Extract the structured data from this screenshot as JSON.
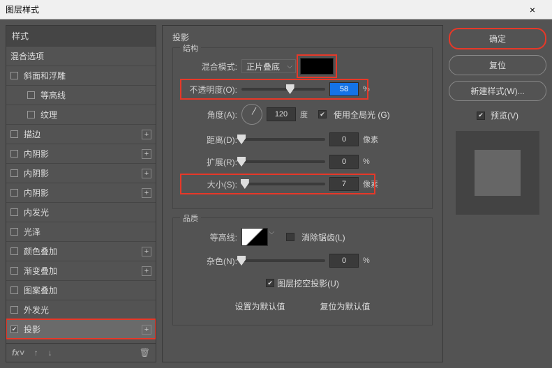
{
  "window": {
    "title": "图层样式",
    "close": "×"
  },
  "left": {
    "header": "样式",
    "blend_opts": "混合选项",
    "items": [
      {
        "label": "斜面和浮雕",
        "chk": false,
        "plus": false,
        "sub": false
      },
      {
        "label": "等高线",
        "chk": false,
        "plus": false,
        "sub": true
      },
      {
        "label": "纹理",
        "chk": false,
        "plus": false,
        "sub": true
      },
      {
        "label": "描边",
        "chk": false,
        "plus": true,
        "sub": false
      },
      {
        "label": "内阴影",
        "chk": false,
        "plus": true,
        "sub": false
      },
      {
        "label": "内阴影",
        "chk": false,
        "plus": true,
        "sub": false
      },
      {
        "label": "内阴影",
        "chk": false,
        "plus": true,
        "sub": false
      },
      {
        "label": "内发光",
        "chk": false,
        "plus": false,
        "sub": false
      },
      {
        "label": "光泽",
        "chk": false,
        "plus": false,
        "sub": false
      },
      {
        "label": "颜色叠加",
        "chk": false,
        "plus": true,
        "sub": false
      },
      {
        "label": "渐变叠加",
        "chk": false,
        "plus": true,
        "sub": false
      },
      {
        "label": "图案叠加",
        "chk": false,
        "plus": false,
        "sub": false
      },
      {
        "label": "外发光",
        "chk": false,
        "plus": false,
        "sub": false
      },
      {
        "label": "投影",
        "chk": true,
        "plus": true,
        "sub": false,
        "active": true
      }
    ]
  },
  "center": {
    "title": "投影",
    "struct_legend": "结构",
    "blend_mode_label": "混合模式:",
    "blend_mode_value": "正片叠底",
    "opacity_label": "不透明度(O):",
    "opacity_value": "58",
    "opacity_unit": "%",
    "angle_label": "角度(A):",
    "angle_value": "120",
    "angle_unit": "度",
    "global_light_label": "使用全局光 (G)",
    "distance_label": "距离(D):",
    "distance_value": "0",
    "px": "像素",
    "spread_label": "扩展(R):",
    "spread_value": "0",
    "percent": "%",
    "size_label": "大小(S):",
    "size_value": "7",
    "quality_legend": "品质",
    "contour_label": "等高线:",
    "antialias_label": "消除锯齿(L)",
    "noise_label": "杂色(N):",
    "noise_value": "0",
    "knockout_label": "图层挖空投影(U)",
    "btn_default": "设置为默认值",
    "btn_reset": "复位为默认值"
  },
  "right": {
    "ok": "确定",
    "cancel": "复位",
    "newstyle": "新建样式(W)...",
    "preview": "预览(V)"
  }
}
